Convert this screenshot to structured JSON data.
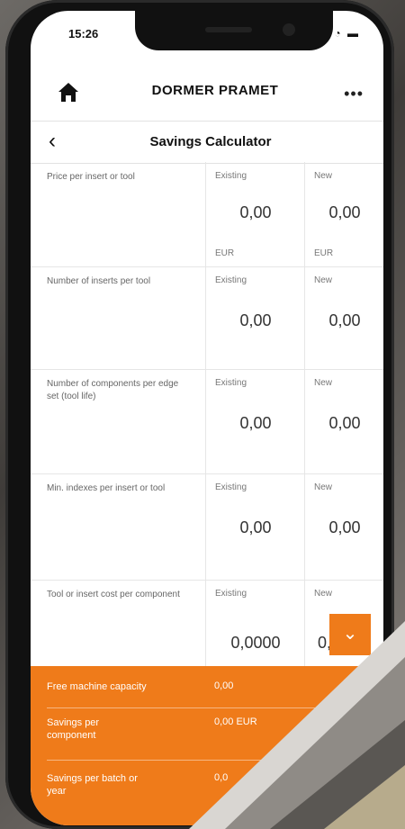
{
  "status": {
    "time": "15:26",
    "icons": "▪▪ ◔ ▬"
  },
  "header": {
    "brand": "DORMER PRAMET",
    "more": "•••"
  },
  "screen": {
    "title": "Savings Calculator"
  },
  "rows": [
    {
      "label": "Price per insert or tool",
      "existing_header": "Existing",
      "new_header": "New",
      "existing_value": "0,00",
      "new_value": "0,00",
      "existing_unit": "EUR",
      "new_unit": "EUR"
    },
    {
      "label": "Number of inserts per tool",
      "existing_header": "Existing",
      "new_header": "New",
      "existing_value": "0,00",
      "new_value": "0,00"
    },
    {
      "label": "Number of components per edge set (tool life)",
      "existing_header": "Existing",
      "new_header": "New",
      "existing_value": "0,00",
      "new_value": "0,00"
    },
    {
      "label": "Min. indexes per insert or tool",
      "existing_header": "Existing",
      "new_header": "New",
      "existing_value": "0,00",
      "new_value": "0,00"
    },
    {
      "label": "Tool or insert cost per component",
      "existing_header": "Existing",
      "new_header": "New",
      "existing_value": "0,0000",
      "new_value": "0,00"
    }
  ],
  "summary": [
    {
      "label": "Free machine capacity",
      "value": "0,00"
    },
    {
      "label": "Savings per component",
      "value": "0,00 EUR"
    },
    {
      "label": "Savings per batch or year",
      "value": "0,0"
    }
  ],
  "colors": {
    "accent": "#ef7b1a"
  },
  "icons": {
    "home": "home-icon",
    "more": "more-icon",
    "back": "back-icon",
    "expand": "chevron-down-icon"
  }
}
